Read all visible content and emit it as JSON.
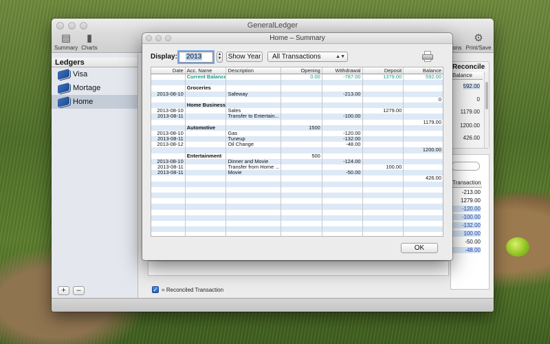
{
  "main_window": {
    "title": "GeneralLedger",
    "toolbar": {
      "summary": "Summary",
      "charts": "Charts",
      "options": "ions",
      "print_save": "Print/Save"
    },
    "sidebar": {
      "header": "Ledgers",
      "items": [
        {
          "label": "Visa",
          "selected": false
        },
        {
          "label": "Mortage",
          "selected": false
        },
        {
          "label": "Home",
          "selected": true
        }
      ],
      "add_label": "+",
      "remove_label": "–"
    },
    "reconcile": {
      "title": "Reconcile",
      "column": "Balance",
      "values": [
        "592.00",
        "0",
        "1179.00",
        "1200.00",
        "426.00"
      ]
    },
    "transactions": {
      "column": "Transaction",
      "values": [
        "-213.00",
        "1279.00",
        "-120.00",
        "-100.00",
        "-132.00",
        "100.00",
        "-50.00",
        "-48.00"
      ]
    },
    "legend_check": "✓",
    "legend_label": "= Reconciled Transaction"
  },
  "dialog": {
    "title": "Home – Summary",
    "display_label": "Display:",
    "year": "2013",
    "stepper_up": "▲",
    "stepper_down": "▼",
    "show_year_label": "Show Year",
    "filter": {
      "selected": "All Transactions",
      "arrow": "▲▼"
    },
    "ok_label": "OK",
    "table": {
      "columns": [
        "Date",
        "Acc. Name",
        "Description",
        "Opening",
        "Withdrawal",
        "Deposit",
        "Balance"
      ],
      "rows": [
        {
          "date": "",
          "acc": "Current Balance",
          "desc": "",
          "opening": "0.00",
          "withdrawal": "-787.00",
          "deposit": "1379.00",
          "balance": "592.00",
          "style": "current"
        },
        {
          "date": "",
          "acc": "",
          "desc": "",
          "opening": "",
          "withdrawal": "",
          "deposit": "",
          "balance": ""
        },
        {
          "date": "",
          "acc": "Groceries",
          "desc": "",
          "opening": "",
          "withdrawal": "",
          "deposit": "",
          "balance": "",
          "style": "category"
        },
        {
          "date": "2013-08-10",
          "acc": "",
          "desc": "Safeway",
          "opening": "",
          "withdrawal": "-213.00",
          "deposit": "",
          "balance": ""
        },
        {
          "date": "",
          "acc": "",
          "desc": "",
          "opening": "",
          "withdrawal": "",
          "deposit": "",
          "balance": "0"
        },
        {
          "date": "",
          "acc": "Home Business",
          "desc": "",
          "opening": "",
          "withdrawal": "",
          "deposit": "",
          "balance": "",
          "style": "category"
        },
        {
          "date": "2013-08-10",
          "acc": "",
          "desc": "Sales",
          "opening": "",
          "withdrawal": "",
          "deposit": "1279.00",
          "balance": ""
        },
        {
          "date": "2013-08-11",
          "acc": "",
          "desc": "Transfer to Entertain...",
          "opening": "",
          "withdrawal": "-100.00",
          "deposit": "",
          "balance": ""
        },
        {
          "date": "",
          "acc": "",
          "desc": "",
          "opening": "",
          "withdrawal": "",
          "deposit": "",
          "balance": "1179.00"
        },
        {
          "date": "",
          "acc": "Automotive",
          "desc": "",
          "opening": "1500",
          "withdrawal": "",
          "deposit": "",
          "balance": "",
          "style": "category"
        },
        {
          "date": "2013-08-10",
          "acc": "",
          "desc": "Gas",
          "opening": "",
          "withdrawal": "-120.00",
          "deposit": "",
          "balance": ""
        },
        {
          "date": "2013-08-11",
          "acc": "",
          "desc": "Tuneup",
          "opening": "",
          "withdrawal": "-132.00",
          "deposit": "",
          "balance": ""
        },
        {
          "date": "2013-08-12",
          "acc": "",
          "desc": "Oil Change",
          "opening": "",
          "withdrawal": "-48.00",
          "deposit": "",
          "balance": ""
        },
        {
          "date": "",
          "acc": "",
          "desc": "",
          "opening": "",
          "withdrawal": "",
          "deposit": "",
          "balance": "1200.00"
        },
        {
          "date": "",
          "acc": "Entertainment",
          "desc": "",
          "opening": "500",
          "withdrawal": "",
          "deposit": "",
          "balance": "",
          "style": "category"
        },
        {
          "date": "2013-08-10",
          "acc": "",
          "desc": "Dinner and Movie",
          "opening": "",
          "withdrawal": "-124.00",
          "deposit": "",
          "balance": ""
        },
        {
          "date": "2013-08-11",
          "acc": "",
          "desc": "Transfer from Home ...",
          "opening": "",
          "withdrawal": "",
          "deposit": "100.00",
          "balance": ""
        },
        {
          "date": "2013-08-11",
          "acc": "",
          "desc": "Movie",
          "opening": "",
          "withdrawal": "-50.00",
          "deposit": "",
          "balance": ""
        },
        {
          "date": "",
          "acc": "",
          "desc": "",
          "opening": "",
          "withdrawal": "",
          "deposit": "",
          "balance": "426.00"
        }
      ]
    }
  },
  "colors": {
    "current_balance": "#1a9a8c",
    "stripe": "#dde9f6",
    "selection": "#c4ccd8",
    "focus_ring": "#7aa7e6"
  }
}
